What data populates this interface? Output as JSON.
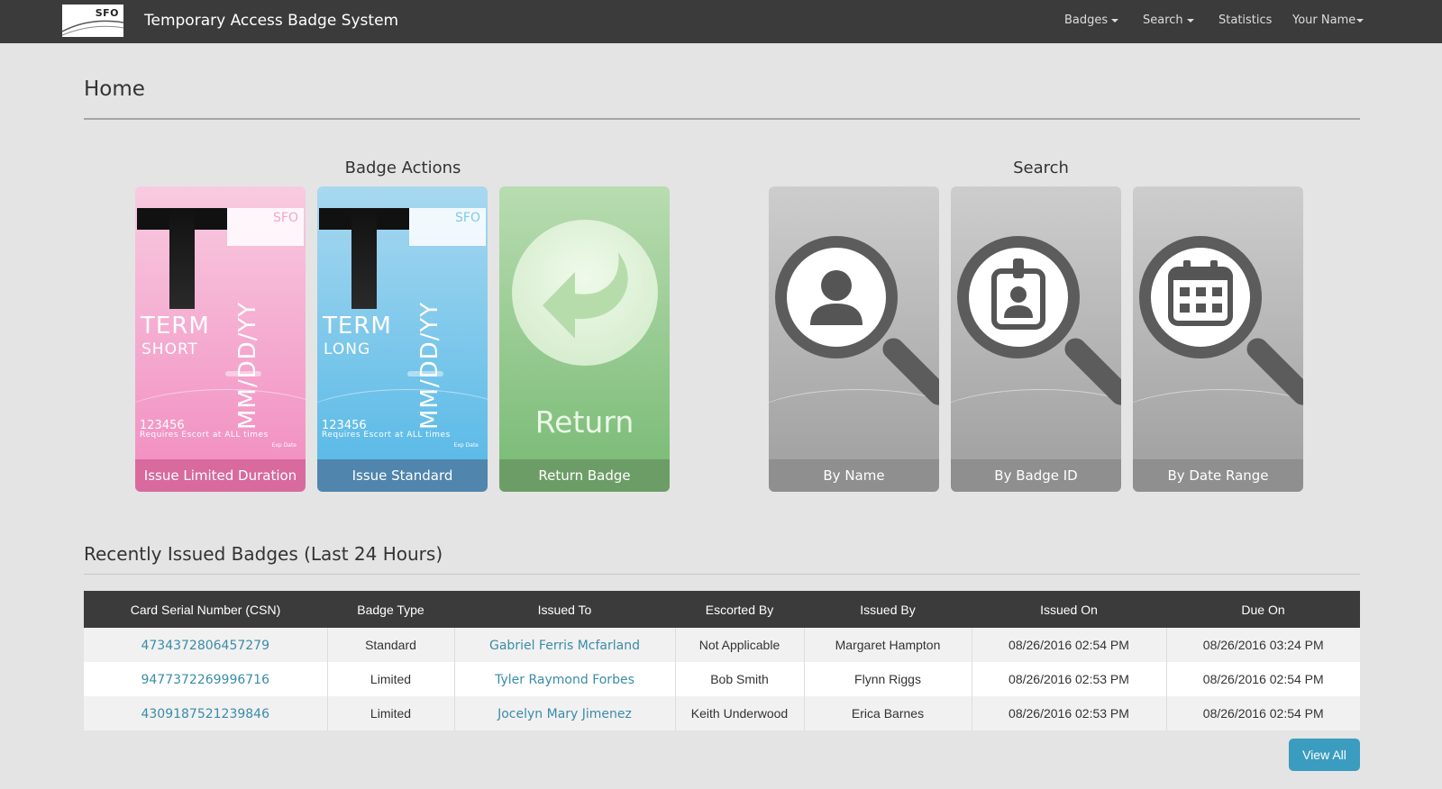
{
  "navbar": {
    "logo_text": "SFO",
    "brand": "Temporary Access Badge System",
    "items": [
      {
        "label": "Badges",
        "dropdown": true
      },
      {
        "label": "Search",
        "dropdown": true
      },
      {
        "label": "Statistics",
        "dropdown": false
      },
      {
        "label": "Your Name",
        "dropdown": true
      }
    ]
  },
  "page": {
    "title": "Home"
  },
  "badge_actions": {
    "title": "Badge Actions",
    "tiles": [
      {
        "caption": "Issue Limited Duration",
        "term": "TERM",
        "term_sub": "SHORT",
        "date": "MM/DD/YY",
        "card_number": "123456",
        "note": "Requires Escort at ALL times",
        "exp": "Exp Date",
        "flag": "SFO"
      },
      {
        "caption": "Issue Standard",
        "term": "TERM",
        "term_sub": "LONG",
        "date": "MM/DD/YY",
        "card_number": "123456",
        "note": "Requires Escort at ALL times",
        "exp": "Exp Date",
        "flag": "SFO"
      },
      {
        "caption": "Return Badge",
        "face_label": "Return"
      }
    ]
  },
  "search": {
    "title": "Search",
    "tiles": [
      {
        "caption": "By Name",
        "icon": "person-icon"
      },
      {
        "caption": "By Badge ID",
        "icon": "badge-id-icon"
      },
      {
        "caption": "By Date Range",
        "icon": "calendar-icon"
      }
    ]
  },
  "recent": {
    "title": "Recently Issued Badges (Last 24 Hours)",
    "columns": [
      "Card Serial Number (CSN)",
      "Badge Type",
      "Issued To",
      "Escorted By",
      "Issued By",
      "Issued On",
      "Due On"
    ],
    "rows": [
      {
        "csn": "4734372806457279",
        "type": "Standard",
        "issued_to": "Gabriel Ferris Mcfarland",
        "escorted_by": "Not Applicable",
        "issued_by": "Margaret Hampton",
        "issued_on": "08/26/2016 02:54 PM",
        "due_on": "08/26/2016 03:24 PM"
      },
      {
        "csn": "9477372269996716",
        "type": "Limited",
        "issued_to": "Tyler Raymond Forbes",
        "escorted_by": "Bob Smith",
        "issued_by": "Flynn Riggs",
        "issued_on": "08/26/2016 02:53 PM",
        "due_on": "08/26/2016 02:54 PM"
      },
      {
        "csn": "4309187521239846",
        "type": "Limited",
        "issued_to": "Jocelyn Mary Jimenez",
        "escorted_by": "Keith Underwood",
        "issued_by": "Erica Barnes",
        "issued_on": "08/26/2016 02:53 PM",
        "due_on": "08/26/2016 02:54 PM"
      }
    ],
    "view_all": "View All"
  },
  "colors": {
    "navbar": "#3b3b3b",
    "link": "#3a8ca8",
    "button": "#3a9dbf",
    "pink_caption": "#d86a9e",
    "blue_caption": "#5085ad",
    "green_caption": "#6d9d66",
    "gray_caption": "#8f8f8f"
  }
}
